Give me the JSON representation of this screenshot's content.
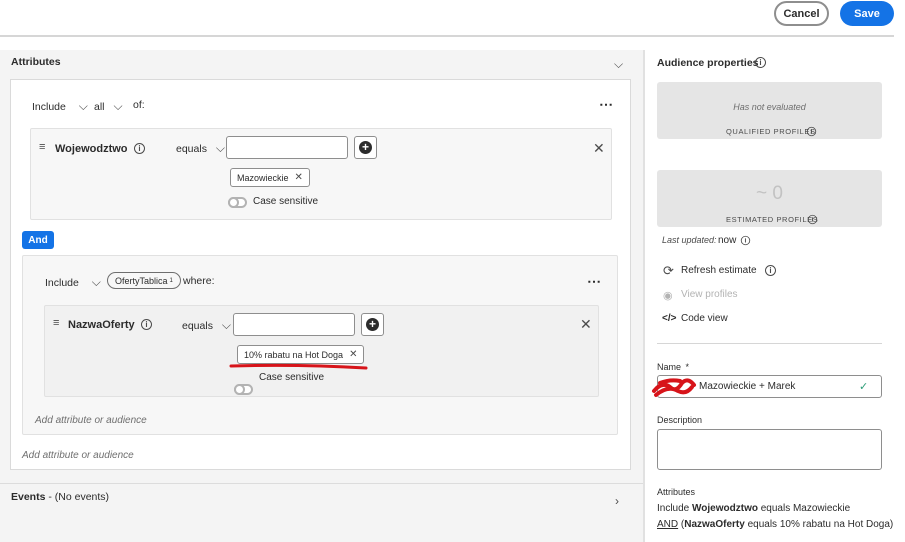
{
  "header": {
    "cancel_label": "Cancel",
    "save_label": "Save"
  },
  "attributes": {
    "title": "Attributes",
    "group1": {
      "include_label": "Include",
      "quantifier": "all",
      "of_label": "of:",
      "rule": {
        "attribute": "Wojewodztwo",
        "operator": "equals",
        "input_value": "",
        "tag": "Mazowieckie",
        "case_label": "Case sensitive"
      }
    },
    "and_label": "And",
    "group2": {
      "include_label": "Include",
      "audience_badge": "OfertyTablica",
      "badge_superscript": "1",
      "where_label": "where:",
      "rule": {
        "attribute": "NazwaOferty",
        "operator": "equals",
        "input_value": "",
        "tag": "10% rabatu na Hot Doga",
        "case_label": "Case sensitive"
      },
      "add_link": "Add attribute or audience"
    },
    "add_link": "Add attribute or audience"
  },
  "events": {
    "title": "Events",
    "subtitle": " - (No events)"
  },
  "audience_properties": {
    "title": "Audience properties",
    "qualified": {
      "status": "Has not evaluated",
      "caption": "QUALIFIED PROFILES"
    },
    "estimated": {
      "value": "~ 0",
      "caption": "ESTIMATED PROFILES"
    },
    "last_updated_label": "Last updated:",
    "last_updated_value": "now",
    "refresh_label": "Refresh estimate",
    "view_profiles_label": "View profiles",
    "code_view_label": "Code view",
    "name_label": "Name",
    "name_required": "*",
    "name_value": "Mazowieckie + Marek",
    "description_label": "Description",
    "description_value": "",
    "attributes_label": "Attributes",
    "summary": {
      "line1_prefix": "Include ",
      "line1_attr": "Wojewodztwo",
      "line1_suffix": " equals Mazowieckie",
      "line2_and": "AND",
      "line2_open": " (",
      "line2_attr": "NazwaOferty",
      "line2_suffix": " equals 10% rabatu na Hot Doga)"
    }
  },
  "colors": {
    "accent": "#1473e6",
    "annotation": "#d7141a",
    "valid": "#2d9d78"
  }
}
